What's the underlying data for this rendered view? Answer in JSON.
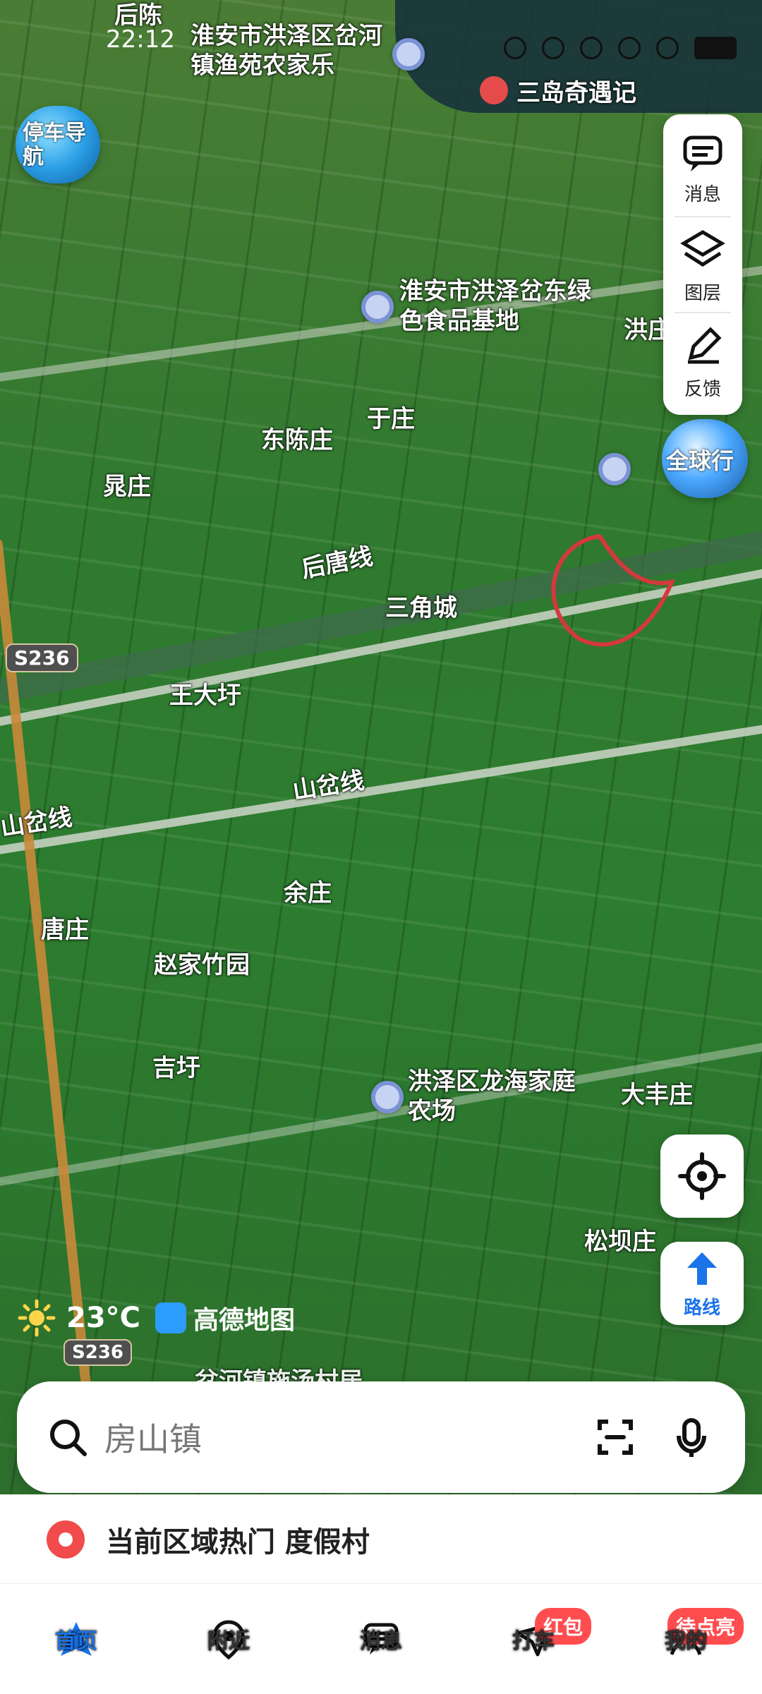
{
  "status_bar": {
    "time": "22:12"
  },
  "map": {
    "labels": [
      {
        "text": "后陈"
      },
      {
        "text": "淮安市洪泽区岔河镇渔苑农家乐"
      },
      {
        "text": "三岛奇遇记"
      },
      {
        "text": "淮安市洪泽岔东绿色食品基地"
      },
      {
        "text": "洪庄"
      },
      {
        "text": "于庄"
      },
      {
        "text": "东陈庄"
      },
      {
        "text": "晁庄"
      },
      {
        "text": "后唐线"
      },
      {
        "text": "三角城"
      },
      {
        "text": "王大圩"
      },
      {
        "text": "山岔线"
      },
      {
        "text": "山岔线"
      },
      {
        "text": "余庄"
      },
      {
        "text": "唐庄"
      },
      {
        "text": "赵家竹园"
      },
      {
        "text": "吉圩"
      },
      {
        "text": "洪泽区龙海家庭农场"
      },
      {
        "text": "大丰庄"
      },
      {
        "text": "松坝庄"
      },
      {
        "text": "岔河镇施汤村居"
      }
    ],
    "road_tags": [
      "S236",
      "S236"
    ]
  },
  "floating_promos": {
    "left_logo": "停车导航",
    "right_logo": "全球行"
  },
  "right_panel": {
    "messages_label": "消息",
    "layers_label": "图层",
    "feedback_label": "反馈"
  },
  "map_buttons": {
    "route_label": "路线"
  },
  "weather": {
    "temp": "23°C",
    "brand": "高德地图"
  },
  "search": {
    "placeholder": "房山镇"
  },
  "hot_area": {
    "text": "当前区域热门 度假村"
  },
  "nav": {
    "items": [
      {
        "label": "首页"
      },
      {
        "label": "附近"
      },
      {
        "label": "消息"
      },
      {
        "label": "打车",
        "badge": "红包"
      },
      {
        "label": "我的",
        "badge": "待点亮"
      }
    ]
  }
}
